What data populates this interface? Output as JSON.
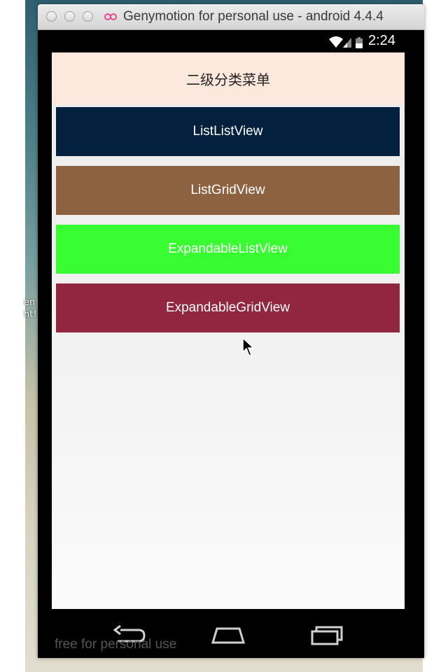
{
  "window": {
    "title": "Genymotion for personal use - android 4.4.4"
  },
  "statusbar": {
    "time": "2:24"
  },
  "app": {
    "title": "二级分类菜单"
  },
  "menu": {
    "items": [
      {
        "label": "ListListView",
        "color": "#03213f"
      },
      {
        "label": "ListGridView",
        "color": "#8d6241"
      },
      {
        "label": "ExpandableListView",
        "color": "#38fd31"
      },
      {
        "label": "ExpandableGridView",
        "color": "#922640"
      }
    ]
  },
  "desktop": {
    "snippet": "en\nht!"
  },
  "watermark": "free for personal use",
  "icons": [
    "wifi-icon",
    "signal-icon",
    "battery-icon",
    "back-icon",
    "home-icon",
    "recent-apps-icon",
    "mouse-cursor-icon"
  ]
}
